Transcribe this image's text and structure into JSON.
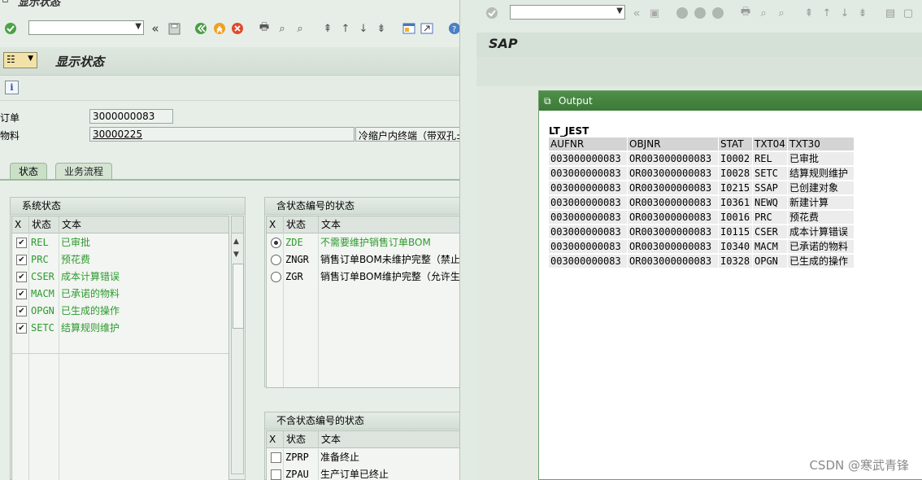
{
  "left_window": {
    "window_title": "显示状态",
    "page_title": "显示状态",
    "fields": {
      "order_label": "订单",
      "order_value": "3000000083",
      "material_label": "物料",
      "material_value": "30000225",
      "material_desc": "冷缩户内终端（带双孔±"
    },
    "tabs": [
      {
        "label": "状态",
        "active": true
      },
      {
        "label": "业务流程",
        "active": false
      }
    ],
    "system_status": {
      "title": "系统状态",
      "columns": [
        "X",
        "状态",
        "文本"
      ],
      "rows": [
        {
          "checked": true,
          "code": "REL",
          "text": "已审批"
        },
        {
          "checked": true,
          "code": "PRC",
          "text": "预花费"
        },
        {
          "checked": true,
          "code": "CSER",
          "text": "成本计算错误"
        },
        {
          "checked": true,
          "code": "MACM",
          "text": "已承诺的物料"
        },
        {
          "checked": true,
          "code": "OPGN",
          "text": "已生成的操作"
        },
        {
          "checked": true,
          "code": "SETC",
          "text": "结算规则维护"
        }
      ]
    },
    "user_status_with_number": {
      "title": "含状态编号的状态",
      "columns": [
        "X",
        "状态",
        "文本"
      ],
      "rows": [
        {
          "selected": true,
          "code": "ZDE",
          "text": "不需要维护销售订单BOM"
        },
        {
          "selected": false,
          "code": "ZNGR",
          "text": "销售订单BOM未维护完整（禁止生"
        },
        {
          "selected": false,
          "code": "ZGR",
          "text": "销售订单BOM维护完整（允许生产"
        }
      ]
    },
    "user_status_without_number": {
      "title": "不含状态编号的状态",
      "columns": [
        "X",
        "状态",
        "文本"
      ],
      "rows": [
        {
          "checked": false,
          "code": "ZPRP",
          "text": "准备终止"
        },
        {
          "checked": false,
          "code": "ZPAU",
          "text": "生产订单已终止"
        }
      ]
    },
    "colors": {
      "status_green": "#2e9a2e"
    }
  },
  "right_window": {
    "sap_title": "SAP",
    "popup": {
      "title": "Output",
      "table_name": "LT_JEST",
      "columns": [
        "AUFNR",
        "OBJNR",
        "STAT",
        "TXT04",
        "TXT30"
      ],
      "rows": [
        [
          "003000000083",
          "OR003000000083",
          "I0002",
          "REL",
          "已审批"
        ],
        [
          "003000000083",
          "OR003000000083",
          "I0028",
          "SETC",
          "结算规则维护"
        ],
        [
          "003000000083",
          "OR003000000083",
          "I0215",
          "SSAP",
          "已创建对象"
        ],
        [
          "003000000083",
          "OR003000000083",
          "I0361",
          "NEWQ",
          "新建计算"
        ],
        [
          "003000000083",
          "OR003000000083",
          "I0016",
          "PRC",
          "预花费"
        ],
        [
          "003000000083",
          "OR003000000083",
          "I0115",
          "CSER",
          "成本计算错误"
        ],
        [
          "003000000083",
          "OR003000000083",
          "I0340",
          "MACM",
          "已承诺的物料"
        ],
        [
          "003000000083",
          "OR003000000083",
          "I0328",
          "OPGN",
          "已生成的操作"
        ]
      ]
    }
  },
  "watermark": "CSDN @寒武青锋"
}
